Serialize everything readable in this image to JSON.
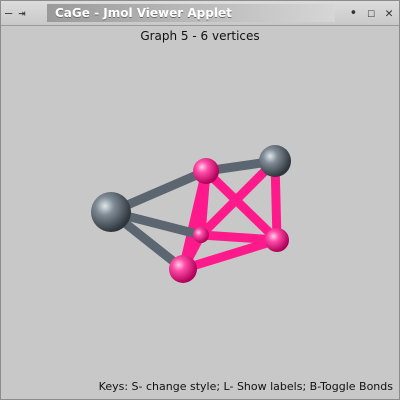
{
  "window": {
    "title": "CaGe - Jmol Viewer Applet",
    "controls": {
      "minimize": "—",
      "pin": "⇥",
      "more": "•",
      "maximize": "☐",
      "close": "✕"
    }
  },
  "viewer": {
    "graph_title": "Graph 5 - 6 vertices",
    "status_text": "Keys: S- change style; L- Show labels; B-Toggle Bonds",
    "colors": {
      "background": "#c8c8c8",
      "magenta": "#ff1a8c",
      "gray": "#5b6670"
    }
  }
}
